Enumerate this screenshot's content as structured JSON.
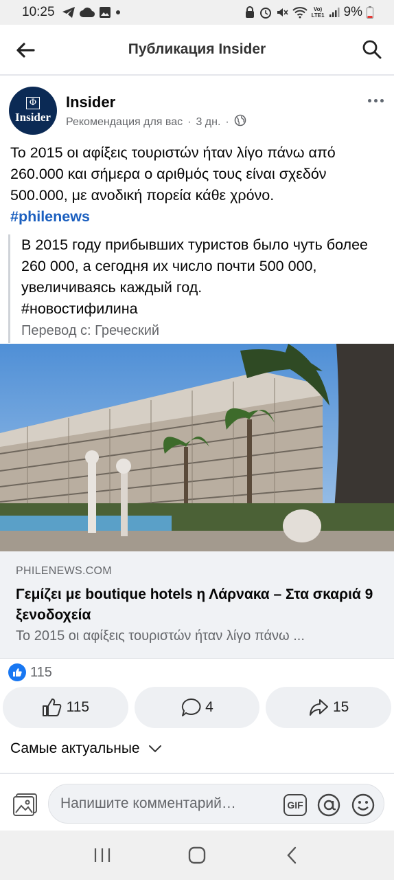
{
  "status_bar": {
    "time": "10:25",
    "battery": "9%",
    "network_top": "Vo)",
    "network_bottom": "LTE1"
  },
  "header": {
    "title": "Публикация Insider"
  },
  "post": {
    "page_name": "Insider",
    "avatar_text": "Insider",
    "avatar_mark": "Φ",
    "meta": "Рекомендация для вас",
    "time": "3 дн.",
    "text": "Το 2015 οι αφίξεις τουριστών ήταν λίγο πάνω από 260.000 και σήμερα ο αριθμός τους είναι σχεδόν 500.000, με ανοδική πορεία κάθε χρόνο.",
    "hashtag": "#philenews",
    "translation": "В 2015 году прибывших туристов было чуть более 260 000, а сегодня их число почти 500 000, увеличиваясь каждый год.",
    "translation_hashtag": "#новостифилина",
    "translation_source": "Перевод с: Греческий"
  },
  "link": {
    "domain": "PHILENEWS.COM",
    "title": "Γεμίζει με boutique hotels η Λάρνακα – Στα σκαριά 9 ξενοδοχεία",
    "description": "Το 2015 οι αφίξεις τουριστών ήταν λίγο πάνω ..."
  },
  "reactions": {
    "count": "115"
  },
  "actions": {
    "like_count": "115",
    "comment_count": "4",
    "share_count": "15"
  },
  "sort": {
    "label": "Самые актуальные"
  },
  "composer": {
    "placeholder": "Напишите комментарий…",
    "gif_label": "GIF"
  },
  "colors": {
    "accent": "#1877f2",
    "hashtag": "#1b5fbf"
  }
}
